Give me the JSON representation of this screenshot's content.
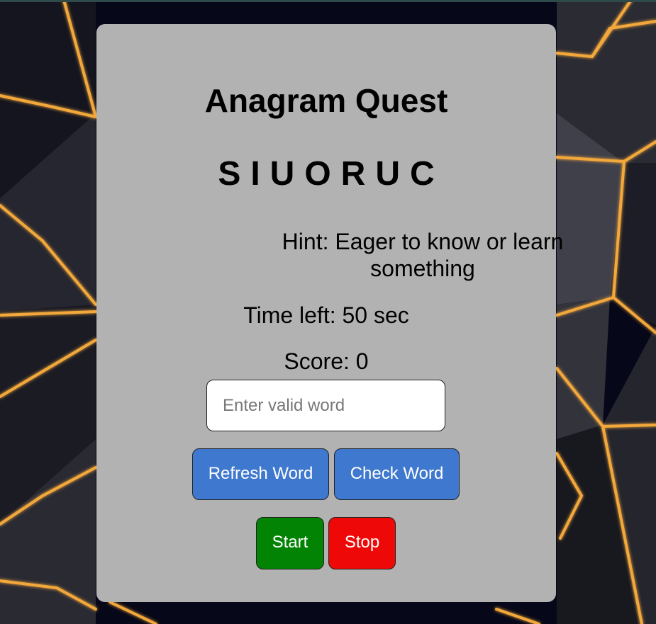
{
  "game": {
    "title": "Anagram Quest",
    "scrambled_word": "SIUORUC",
    "hint_label": "Hint:",
    "hint_text": "Eager to know or learn something",
    "time_label": "Time left:",
    "time_value": "50",
    "time_unit": "sec",
    "score_label": "Score:",
    "score_value": "0"
  },
  "input": {
    "value": "",
    "placeholder": "Enter valid word"
  },
  "buttons": {
    "refresh_label": "Refresh Word",
    "check_label": "Check Word",
    "start_label": "Start",
    "stop_label": "Stop"
  },
  "colors": {
    "card_bg": "#b2b2b2",
    "primary_button": "#3f78cf",
    "start_button": "#038303",
    "stop_button": "#ee0808",
    "background": "#060718",
    "accent_gold": "#f3a83b"
  }
}
